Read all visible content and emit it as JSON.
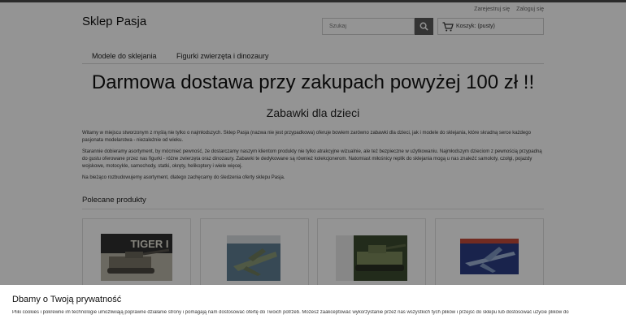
{
  "header": {
    "logo": "Sklep Pasja",
    "register": "Zarejestruj się",
    "login": "Zaloguj się",
    "search_placeholder": "Szukaj",
    "cart_label": "Koszyk: (pusty)"
  },
  "nav": {
    "items": [
      {
        "label": "Modele do sklejania"
      },
      {
        "label": "Figurki zwierzęta i dinozaury"
      }
    ]
  },
  "main": {
    "promo": "Darmowa dostawa przy zakupach powyżej 100 zł !!",
    "title": "Zabawki dla dzieci",
    "paragraphs": [
      "Witamy w miejscu stworzonym z myślą nie tylko o najmłodszych. Sklep Pasja (nazwa nie jest przypadkowa) oferuje bowiem zarówno zabawki dla dzieci, jak i modele do sklejania, które skradną serce każdego pasjonata modelarstwa - niezależnie od wieku.",
      "Starannie dobieramy asortyment, by mócmieć pewność, że dostarczamy naszym klientom produkty nie tylko atrakcyjne wizualnie, ale też bezpieczne w użytkowaniu. Najmłodszym dzieciom z pewnością przypadną do gustu oferowane przez nas figurki - różne zwierzęta oraz dinozaury. Zabawki te dedykowane są również kolekcjonerom. Natomiast miłośnicy replik do sklejania mogą u nas znaleźć samoloty, czołgi, pojazdy wojskowe, motocykle, samochody, statki, okręty, helikoptery i wiele więcej.",
      "Na bieżąco rozbudowujemy asortyment, dlatego zachęcamy do śledzenia oferty sklepu Pasja."
    ],
    "featured_heading": "Polecane produkty",
    "products": [
      {
        "box_text": "TIGER I",
        "colors": [
          "#2f2f2f",
          "#b9b6a8"
        ]
      },
      {
        "box_text": "",
        "colors": [
          "#5f7f93",
          "#8a9a78"
        ]
      },
      {
        "box_text": "",
        "colors": [
          "#3b4a2f",
          "#7d8b5c"
        ]
      },
      {
        "box_text": "",
        "colors": [
          "#2c3d84",
          "#c44a3a"
        ]
      }
    ]
  },
  "cookie": {
    "title": "Dbamy o Twoją prywatność",
    "text": "Pliki cookies i pokrewne im technologie umożliwiają poprawne działanie strony i pomagają nam dostosować ofertę do Twoich potrzeb. Możesz zaakceptować wykorzystanie przez nas wszystkich tych plików i przejść do sklepu lub dostosować użycie plików do"
  }
}
